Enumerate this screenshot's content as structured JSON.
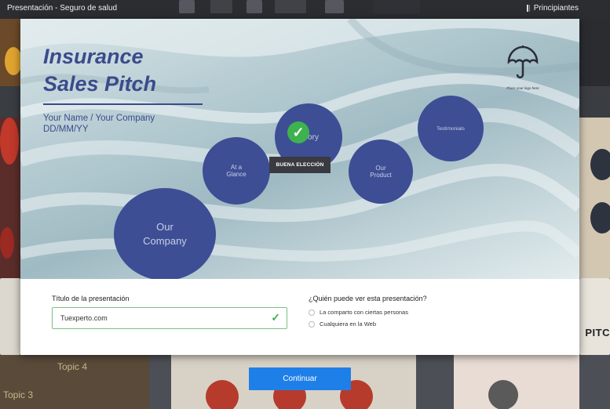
{
  "header": {
    "title": "Presentación - Seguro de salud",
    "right_label": "Principiantes"
  },
  "preview": {
    "title_line1": "Insurance",
    "title_line2": "Sales Pitch",
    "subtitle_line1": "Your Name / Your Company",
    "subtitle_line2": "DD/MM/YY",
    "bubbles": {
      "our_company": "Our Company",
      "at_a_glance": "At a Glance",
      "history": "ory",
      "our_product": "Our Product",
      "testimonials": "Testimonials"
    },
    "badge": "BUENA ELECCIÓN",
    "logo_caption": "Place your logo here"
  },
  "form": {
    "title_label": "Título de la presentación",
    "title_value": "Tuexperto.com",
    "visibility_label": "¿Quién puede ver esta presentación?",
    "options": [
      "La comparto con ciertas personas",
      "Cualquiera en la Web"
    ]
  },
  "background": {
    "topic3": "Topic 3",
    "topic4": "Topic 4",
    "pitc": "PITC"
  },
  "continue_label": "Continuar",
  "colors": {
    "accent": "#1f7fe8",
    "bubble": "#3d4e95",
    "success": "#3db24f",
    "title": "#3a4b8c"
  }
}
